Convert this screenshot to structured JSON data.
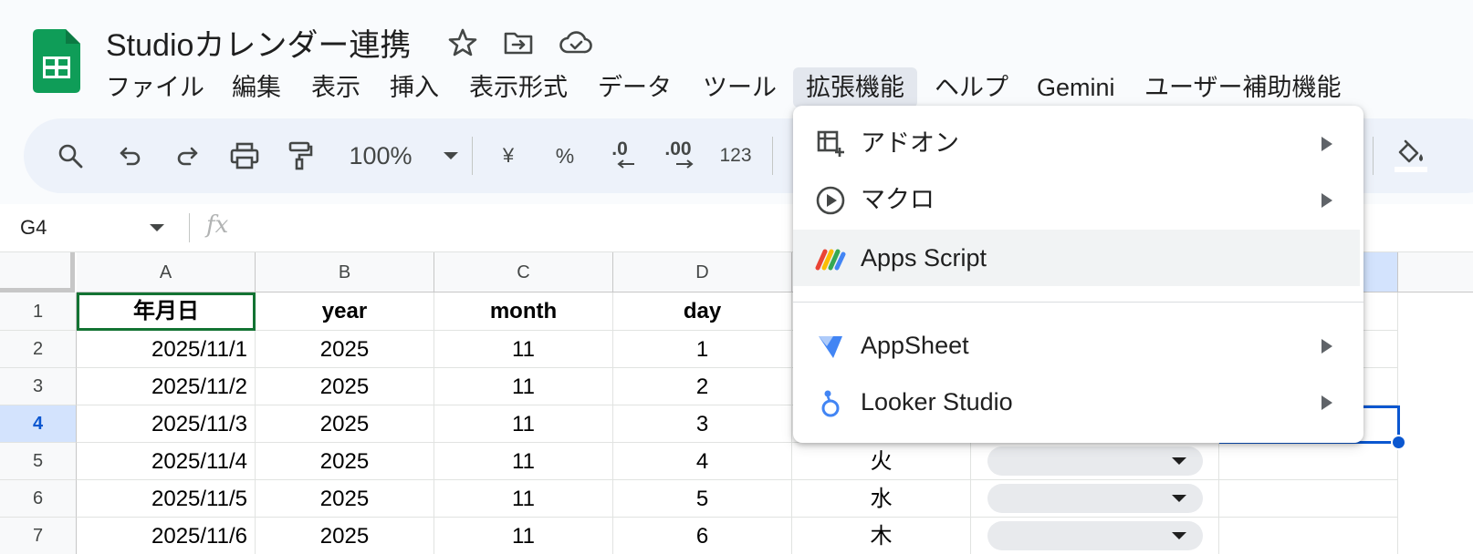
{
  "document": {
    "title": "Studioカレンダー連携"
  },
  "menubar": {
    "items": [
      {
        "label": "ファイル"
      },
      {
        "label": "編集"
      },
      {
        "label": "表示"
      },
      {
        "label": "挿入"
      },
      {
        "label": "表示形式"
      },
      {
        "label": "データ"
      },
      {
        "label": "ツール"
      },
      {
        "label": "拡張機能",
        "active": true
      },
      {
        "label": "ヘルプ"
      },
      {
        "label": "Gemini"
      },
      {
        "label": "ユーザー補助機能"
      }
    ]
  },
  "toolbar": {
    "zoom": "100%",
    "currency": "¥",
    "percent": "%",
    "decrease_decimal": ".0",
    "increase_decimal": ".00",
    "number_format": "123"
  },
  "formula_bar": {
    "cell_ref": "G4",
    "fx": "fx"
  },
  "grid": {
    "columns": [
      "A",
      "B",
      "C",
      "D"
    ],
    "selected_row": "4",
    "rows": [
      {
        "num": "1",
        "cells": [
          "年月日",
          "year",
          "month",
          "day"
        ],
        "weekday": ""
      },
      {
        "num": "2",
        "cells": [
          "2025/11/1",
          "2025",
          "11",
          "1"
        ],
        "weekday": ""
      },
      {
        "num": "3",
        "cells": [
          "2025/11/2",
          "2025",
          "11",
          "2"
        ],
        "weekday": ""
      },
      {
        "num": "4",
        "cells": [
          "2025/11/3",
          "2025",
          "11",
          "3"
        ],
        "weekday": ""
      },
      {
        "num": "5",
        "cells": [
          "2025/11/4",
          "2025",
          "11",
          "4"
        ],
        "weekday": "火"
      },
      {
        "num": "6",
        "cells": [
          "2025/11/5",
          "2025",
          "11",
          "5"
        ],
        "weekday": "水"
      },
      {
        "num": "7",
        "cells": [
          "2025/11/6",
          "2025",
          "11",
          "6"
        ],
        "weekday": "木"
      }
    ]
  },
  "extensions_menu": {
    "items": [
      {
        "label": "アドオン",
        "icon": "addon-icon",
        "submenu": true
      },
      {
        "label": "マクロ",
        "icon": "macro-play-icon",
        "submenu": true
      },
      {
        "label": "Apps Script",
        "icon": "apps-script-icon",
        "submenu": false,
        "highlighted": true
      },
      {
        "label": "AppSheet",
        "icon": "appsheet-icon",
        "submenu": true
      },
      {
        "label": "Looker Studio",
        "icon": "looker-studio-icon",
        "submenu": true
      }
    ]
  },
  "colors": {
    "sheets_green": "#0f9d58",
    "selection_blue": "#0b57d0",
    "active_cell_green": "#137333",
    "toolbar_bg": "#edf2fa"
  }
}
